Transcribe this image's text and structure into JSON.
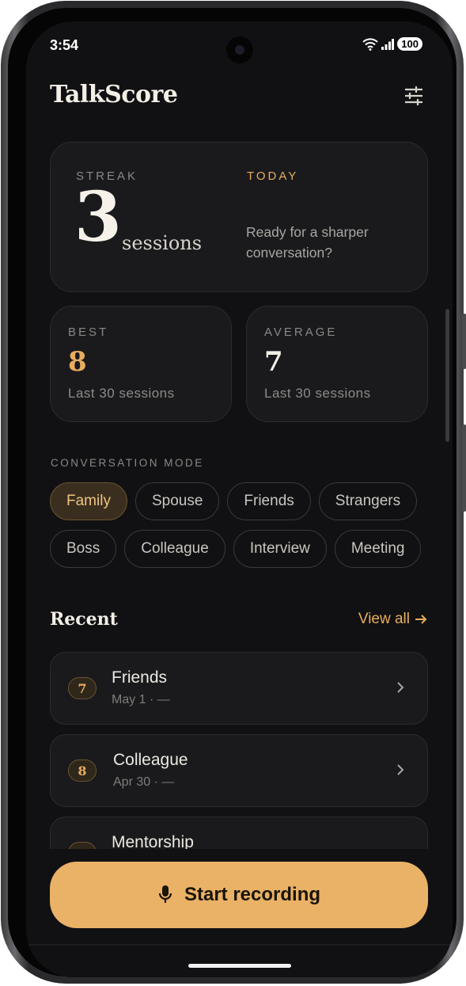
{
  "status_bar": {
    "time": "3:54",
    "battery": "100"
  },
  "app": {
    "title": "TalkScore"
  },
  "streak": {
    "label": "STREAK",
    "value": "3",
    "unit": "sessions",
    "today_label": "TODAY",
    "today_message": "Ready for a sharper conversation?"
  },
  "stats": [
    {
      "label": "BEST",
      "value": "8",
      "caption": "Last 30 sessions"
    },
    {
      "label": "AVERAGE",
      "value": "7",
      "caption": "Last 30 sessions"
    }
  ],
  "modes": {
    "label": "CONVERSATION MODE",
    "selected": "Family",
    "row1": [
      "Family",
      "Spouse",
      "Friends",
      "Strangers"
    ],
    "row2": [
      "Boss",
      "Colleague",
      "Interview",
      "Meeting"
    ]
  },
  "recent": {
    "title": "Recent",
    "view_all": "View all",
    "sessions": [
      {
        "score": "7",
        "name": "Friends",
        "meta": "May 1 · —"
      },
      {
        "score": "8",
        "name": "Colleague",
        "meta": "Apr 30 · —"
      },
      {
        "score": "",
        "name": "Mentorship",
        "meta": ""
      }
    ]
  },
  "cta": {
    "label": "Start recording"
  },
  "colors": {
    "accent": "#e8ad5e",
    "background": "#111113",
    "card": "#1a1a1d",
    "cta": "#e9b266"
  }
}
